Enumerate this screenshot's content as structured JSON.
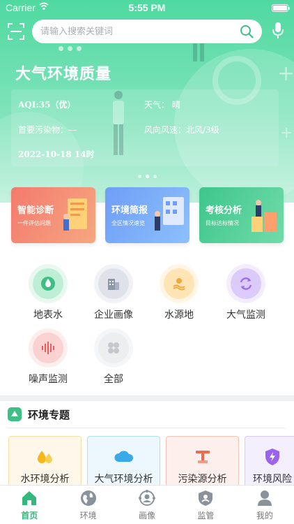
{
  "status_bar": {
    "carrier": "Carrier",
    "time": "5:55 PM"
  },
  "search": {
    "placeholder": "请输入搜索关键词"
  },
  "hero": {
    "title": "大气环境质量",
    "aqi": "AQI:35（优）",
    "weather": "天气：  晴",
    "pollutant": "首要污染物：—",
    "wind": "风向风速：北风/3级",
    "datetime": "2022-10-18 14时",
    "active_page": 2,
    "page_count": 3
  },
  "feature_cards": [
    {
      "title": "智能诊断",
      "subtitle": "一件评估问题"
    },
    {
      "title": "环境简报",
      "subtitle": "全区情况速览"
    },
    {
      "title": "考核分析",
      "subtitle": "目标达标情况"
    }
  ],
  "quick_entries": [
    {
      "label": "地表水",
      "icon": "water-drop-icon",
      "color": "#3dbf85"
    },
    {
      "label": "企业画像",
      "icon": "building-icon",
      "color": "#8c97a8"
    },
    {
      "label": "水源地",
      "icon": "water-source-icon",
      "color": "#f2a93b"
    },
    {
      "label": "大气监测",
      "icon": "air-cycle-icon",
      "color": "#9a6cf0"
    },
    {
      "label": "噪声监测",
      "icon": "sound-wave-icon",
      "color": "#ef5a5a"
    },
    {
      "label": "全部",
      "icon": "grid-four-icon",
      "color": "#c4c8cc"
    }
  ],
  "topics": {
    "header": "环境专题",
    "items": [
      {
        "label": "水环境分析",
        "icon": "droplets-icon",
        "color": "#f4b81c"
      },
      {
        "label": "大气环境分析",
        "icon": "cloud-icon",
        "color": "#3aa9e8"
      },
      {
        "label": "污染源分析",
        "icon": "factory-tap-icon",
        "color": "#ee6b4f"
      },
      {
        "label": "环境风险",
        "icon": "shield-bolt-icon",
        "color": "#9b62ee"
      }
    ]
  },
  "tabs": [
    {
      "label": "首页",
      "icon": "home-icon"
    },
    {
      "label": "环境",
      "icon": "globe-icon"
    },
    {
      "label": "画像",
      "icon": "portrait-icon"
    },
    {
      "label": "监管",
      "icon": "shield-icon"
    },
    {
      "label": "我的",
      "icon": "user-icon"
    }
  ],
  "colors": {
    "accent": "#34b87d",
    "hero_top": "#4fd9a0"
  }
}
